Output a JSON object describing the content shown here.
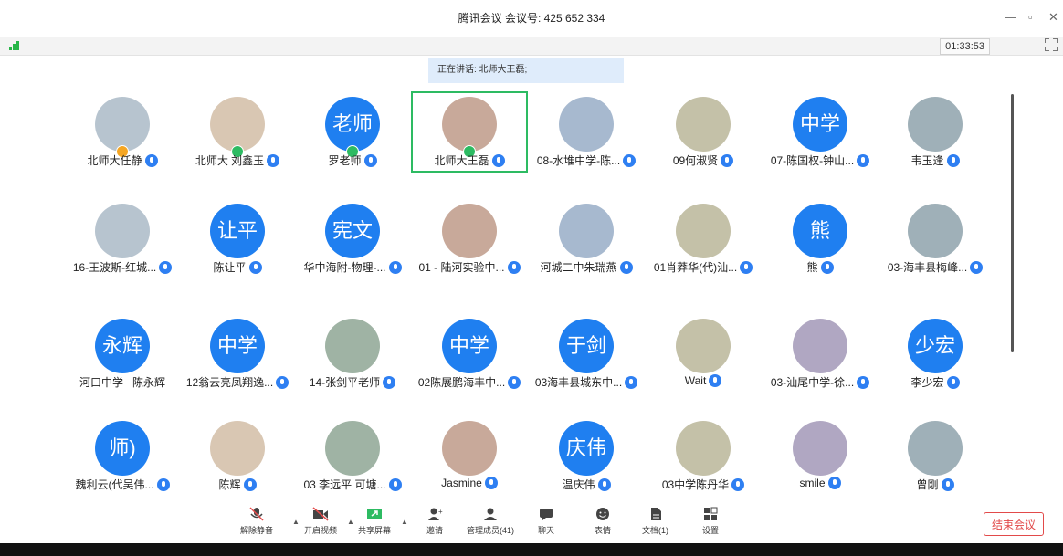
{
  "window": {
    "title": "腾讯会议 会议号: 425 652 334"
  },
  "status": {
    "timer": "01:33:53"
  },
  "speaking": "正在讲话: 北师大王磊;",
  "colors": {
    "accent": "#1f7ff0",
    "active": "#2dbb62",
    "danger": "#e24a4a",
    "host_badge": "#f5a623",
    "cohost_badge": "#2dbb62"
  },
  "participants": [
    {
      "name": "北师大任静",
      "avatar": "photo",
      "badge": "host"
    },
    {
      "name": "北师大 刘鑫玉",
      "avatar": "photo",
      "badge": "cohost"
    },
    {
      "name": "罗老师",
      "avatar_text": "老师",
      "badge": "cohost"
    },
    {
      "name": "北师大王磊",
      "avatar": "photo",
      "badge": "cohost",
      "active": true
    },
    {
      "name": "08-水堆中学-陈...",
      "avatar": "photo"
    },
    {
      "name": "09何淑贤",
      "avatar": "photo"
    },
    {
      "name": "07-陈国权-钟山...",
      "avatar_text": "中学"
    },
    {
      "name": "韦玉逢",
      "avatar": "photo"
    },
    {
      "name": "16-王波斯-红城...",
      "avatar": "photo"
    },
    {
      "name": "陈让平",
      "avatar_text": "让平"
    },
    {
      "name": "华中海附-物理-...",
      "avatar_text": "宪文"
    },
    {
      "name": "01 - 陆河实验中...",
      "avatar": "photo"
    },
    {
      "name": "河城二中朱瑞燕",
      "avatar": "photo"
    },
    {
      "name": "01肖莽华(代)汕...",
      "avatar": "photo"
    },
    {
      "name": "熊",
      "avatar_text": "熊"
    },
    {
      "name": "03-海丰县梅峰...",
      "avatar": "photo"
    },
    {
      "name": "河口中学   陈永辉",
      "avatar_text": "永辉",
      "nomic": true
    },
    {
      "name": "12翁云亮凤翔逸...",
      "avatar_text": "中学"
    },
    {
      "name": "14-张剑平老师",
      "avatar": "photo"
    },
    {
      "name": "02陈展鹏海丰中...",
      "avatar_text": "中学"
    },
    {
      "name": "03海丰县城东中...",
      "avatar_text": "于剑"
    },
    {
      "name": "Wait",
      "avatar": "photo"
    },
    {
      "name": "03-汕尾中学-徐...",
      "avatar": "photo"
    },
    {
      "name": "李少宏",
      "avatar_text": "少宏"
    },
    {
      "name": "魏利云(代吴伟...",
      "avatar_text": "师)"
    },
    {
      "name": "陈辉",
      "avatar": "photo"
    },
    {
      "name": "03 李远平 可塘...",
      "avatar": "photo"
    },
    {
      "name": "Jasmine",
      "avatar": "photo"
    },
    {
      "name": "温庆伟",
      "avatar_text": "庆伟"
    },
    {
      "name": "03中学陈丹华",
      "avatar": "photo"
    },
    {
      "name": "smile",
      "avatar": "photo"
    },
    {
      "name": "曾刚",
      "avatar": "photo"
    }
  ],
  "toolbar": {
    "unmute": "解除静音",
    "video": "开启视频",
    "share": "共享屏幕",
    "invite": "邀请",
    "members": "管理成员(41)",
    "chat": "聊天",
    "emoji": "表情",
    "docs": "文档(1)",
    "settings": "设置",
    "end": "结束会议"
  }
}
